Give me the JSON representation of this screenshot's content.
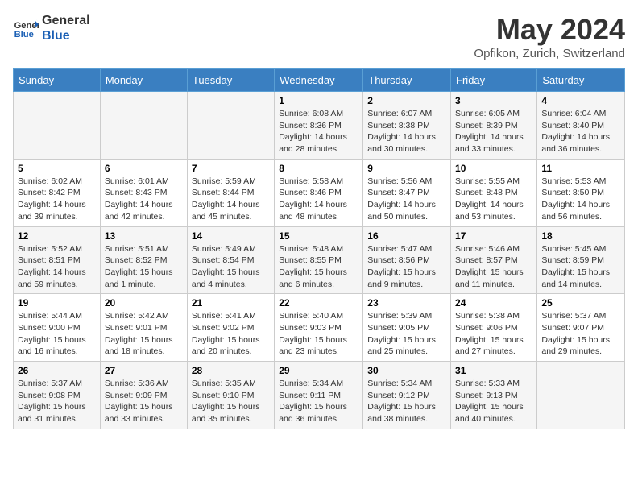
{
  "header": {
    "logo_line1": "General",
    "logo_line2": "Blue",
    "month_title": "May 2024",
    "location": "Opfikon, Zurich, Switzerland"
  },
  "days_of_week": [
    "Sunday",
    "Monday",
    "Tuesday",
    "Wednesday",
    "Thursday",
    "Friday",
    "Saturday"
  ],
  "weeks": [
    [
      {
        "day": "",
        "info": ""
      },
      {
        "day": "",
        "info": ""
      },
      {
        "day": "",
        "info": ""
      },
      {
        "day": "1",
        "info": "Sunrise: 6:08 AM\nSunset: 8:36 PM\nDaylight: 14 hours\nand 28 minutes."
      },
      {
        "day": "2",
        "info": "Sunrise: 6:07 AM\nSunset: 8:38 PM\nDaylight: 14 hours\nand 30 minutes."
      },
      {
        "day": "3",
        "info": "Sunrise: 6:05 AM\nSunset: 8:39 PM\nDaylight: 14 hours\nand 33 minutes."
      },
      {
        "day": "4",
        "info": "Sunrise: 6:04 AM\nSunset: 8:40 PM\nDaylight: 14 hours\nand 36 minutes."
      }
    ],
    [
      {
        "day": "5",
        "info": "Sunrise: 6:02 AM\nSunset: 8:42 PM\nDaylight: 14 hours\nand 39 minutes."
      },
      {
        "day": "6",
        "info": "Sunrise: 6:01 AM\nSunset: 8:43 PM\nDaylight: 14 hours\nand 42 minutes."
      },
      {
        "day": "7",
        "info": "Sunrise: 5:59 AM\nSunset: 8:44 PM\nDaylight: 14 hours\nand 45 minutes."
      },
      {
        "day": "8",
        "info": "Sunrise: 5:58 AM\nSunset: 8:46 PM\nDaylight: 14 hours\nand 48 minutes."
      },
      {
        "day": "9",
        "info": "Sunrise: 5:56 AM\nSunset: 8:47 PM\nDaylight: 14 hours\nand 50 minutes."
      },
      {
        "day": "10",
        "info": "Sunrise: 5:55 AM\nSunset: 8:48 PM\nDaylight: 14 hours\nand 53 minutes."
      },
      {
        "day": "11",
        "info": "Sunrise: 5:53 AM\nSunset: 8:50 PM\nDaylight: 14 hours\nand 56 minutes."
      }
    ],
    [
      {
        "day": "12",
        "info": "Sunrise: 5:52 AM\nSunset: 8:51 PM\nDaylight: 14 hours\nand 59 minutes."
      },
      {
        "day": "13",
        "info": "Sunrise: 5:51 AM\nSunset: 8:52 PM\nDaylight: 15 hours\nand 1 minute."
      },
      {
        "day": "14",
        "info": "Sunrise: 5:49 AM\nSunset: 8:54 PM\nDaylight: 15 hours\nand 4 minutes."
      },
      {
        "day": "15",
        "info": "Sunrise: 5:48 AM\nSunset: 8:55 PM\nDaylight: 15 hours\nand 6 minutes."
      },
      {
        "day": "16",
        "info": "Sunrise: 5:47 AM\nSunset: 8:56 PM\nDaylight: 15 hours\nand 9 minutes."
      },
      {
        "day": "17",
        "info": "Sunrise: 5:46 AM\nSunset: 8:57 PM\nDaylight: 15 hours\nand 11 minutes."
      },
      {
        "day": "18",
        "info": "Sunrise: 5:45 AM\nSunset: 8:59 PM\nDaylight: 15 hours\nand 14 minutes."
      }
    ],
    [
      {
        "day": "19",
        "info": "Sunrise: 5:44 AM\nSunset: 9:00 PM\nDaylight: 15 hours\nand 16 minutes."
      },
      {
        "day": "20",
        "info": "Sunrise: 5:42 AM\nSunset: 9:01 PM\nDaylight: 15 hours\nand 18 minutes."
      },
      {
        "day": "21",
        "info": "Sunrise: 5:41 AM\nSunset: 9:02 PM\nDaylight: 15 hours\nand 20 minutes."
      },
      {
        "day": "22",
        "info": "Sunrise: 5:40 AM\nSunset: 9:03 PM\nDaylight: 15 hours\nand 23 minutes."
      },
      {
        "day": "23",
        "info": "Sunrise: 5:39 AM\nSunset: 9:05 PM\nDaylight: 15 hours\nand 25 minutes."
      },
      {
        "day": "24",
        "info": "Sunrise: 5:38 AM\nSunset: 9:06 PM\nDaylight: 15 hours\nand 27 minutes."
      },
      {
        "day": "25",
        "info": "Sunrise: 5:37 AM\nSunset: 9:07 PM\nDaylight: 15 hours\nand 29 minutes."
      }
    ],
    [
      {
        "day": "26",
        "info": "Sunrise: 5:37 AM\nSunset: 9:08 PM\nDaylight: 15 hours\nand 31 minutes."
      },
      {
        "day": "27",
        "info": "Sunrise: 5:36 AM\nSunset: 9:09 PM\nDaylight: 15 hours\nand 33 minutes."
      },
      {
        "day": "28",
        "info": "Sunrise: 5:35 AM\nSunset: 9:10 PM\nDaylight: 15 hours\nand 35 minutes."
      },
      {
        "day": "29",
        "info": "Sunrise: 5:34 AM\nSunset: 9:11 PM\nDaylight: 15 hours\nand 36 minutes."
      },
      {
        "day": "30",
        "info": "Sunrise: 5:34 AM\nSunset: 9:12 PM\nDaylight: 15 hours\nand 38 minutes."
      },
      {
        "day": "31",
        "info": "Sunrise: 5:33 AM\nSunset: 9:13 PM\nDaylight: 15 hours\nand 40 minutes."
      },
      {
        "day": "",
        "info": ""
      }
    ]
  ]
}
